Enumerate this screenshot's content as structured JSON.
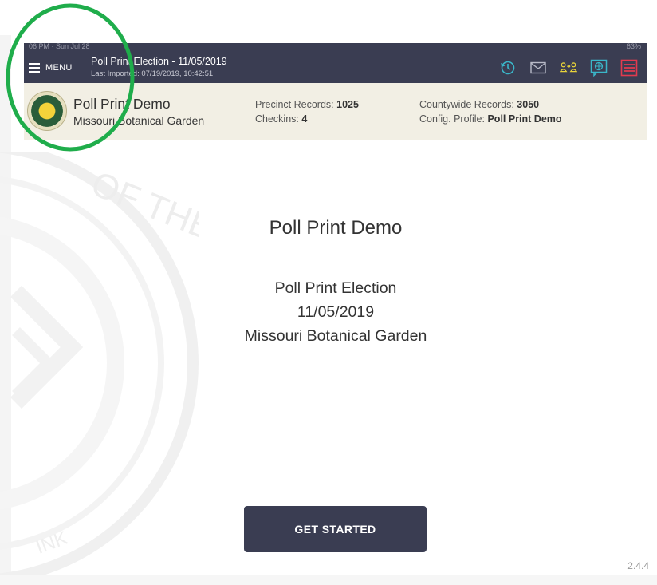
{
  "status_bar": {
    "time": "06 PM · Sun Jul 28",
    "battery": "63%"
  },
  "topbar": {
    "menu_label": "MENU",
    "election_title": "Poll Print Election - 11/05/2019",
    "last_imported": "Last Imported: 07/19/2019, 10:42:51",
    "icons": [
      "history-icon",
      "mail-icon",
      "users-swap-icon",
      "chat-globe-icon",
      "printer-icon"
    ]
  },
  "infobar": {
    "demo_name": "Poll Print Demo",
    "location": "Missouri Botanical Garden",
    "precinct_label": "Precinct Records:",
    "precinct_value": "1025",
    "checkins_label": "Checkins:",
    "checkins_value": "4",
    "countywide_label": "Countywide Records:",
    "countywide_value": "3050",
    "config_label": "Config. Profile:",
    "config_value": "Poll Print Demo"
  },
  "main": {
    "title": "Poll Print Demo",
    "election": "Poll Print Election",
    "date": "11/05/2019",
    "location": "Missouri Botanical Garden",
    "start_button": "GET STARTED"
  },
  "watermark": {
    "text": "OF THE STATE OF",
    "bottom_text": "INK"
  },
  "version": "2.4.4",
  "colors": {
    "navbar": "#3a3d52",
    "infobar": "#f2efe4",
    "accent_yellow": "#e8d33a",
    "accent_teal": "#3ab6c9",
    "accent_red": "#e23a4f",
    "highlight": "#1fad4b"
  }
}
